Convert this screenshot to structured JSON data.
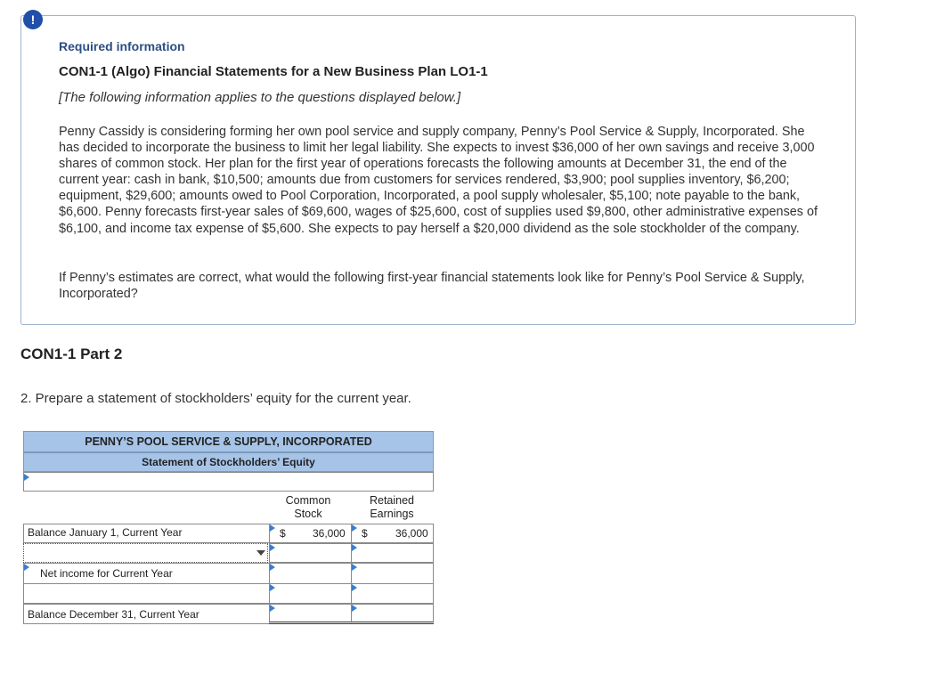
{
  "info": {
    "alert_glyph": "!",
    "required_label": "Required information",
    "title": "CON1-1 (Algo) Financial Statements for a New Business Plan LO1-1",
    "note": "[The following information applies to the questions displayed below.]",
    "paragraph1": "Penny Cassidy is considering forming her own pool service and supply company, Penny’s Pool Service & Supply, Incorporated. She has decided to incorporate the business to limit her legal liability. She expects to invest $36,000 of her own savings and receive 3,000 shares of common stock. Her plan for the first year of operations forecasts the following amounts at December 31, the end of the current year: cash in bank, $10,500; amounts due from customers for services rendered, $3,900; pool supplies inventory, $6,200; equipment, $29,600; amounts owed to Pool Corporation, Incorporated, a pool supply wholesaler, $5,100; note payable to the bank, $6,600. Penny forecasts first-year sales of $69,600, wages of $25,600, cost of supplies used $9,800, other administrative expenses of $6,100, and income tax expense of $5,600. She expects to pay herself a $20,000 dividend as the sole stockholder of the company.",
    "paragraph2": "If Penny’s estimates are correct, what would the following first-year financial statements look like for Penny’s Pool Service & Supply, Incorporated?"
  },
  "part_title": "CON1-1 Part 2",
  "question": "2. Prepare a statement of stockholders’ equity for the current year.",
  "worksheet": {
    "company": "PENNY’S POOL SERVICE & SUPPLY, INCORPORATED",
    "statement": "Statement of Stockholders’ Equity",
    "col1_line1": "Common",
    "col1_line2": "Stock",
    "col2_line1": "Retained",
    "col2_line2": "Earnings",
    "rows": {
      "balance_jan": {
        "label": "Balance January 1, Current Year",
        "cur1": "$",
        "val1": "36,000",
        "cur2": "$",
        "val2": "36,000"
      },
      "dropdown_row": {
        "label": ""
      },
      "net_income": {
        "label": "Net income for Current Year"
      },
      "blank_row": {
        "label": ""
      },
      "balance_dec": {
        "label": "Balance December 31, Current Year"
      }
    }
  },
  "colors": {
    "header_blue": "#a6c4e8",
    "accent": "#3d7cc9",
    "title_blue": "#2b4e84"
  }
}
